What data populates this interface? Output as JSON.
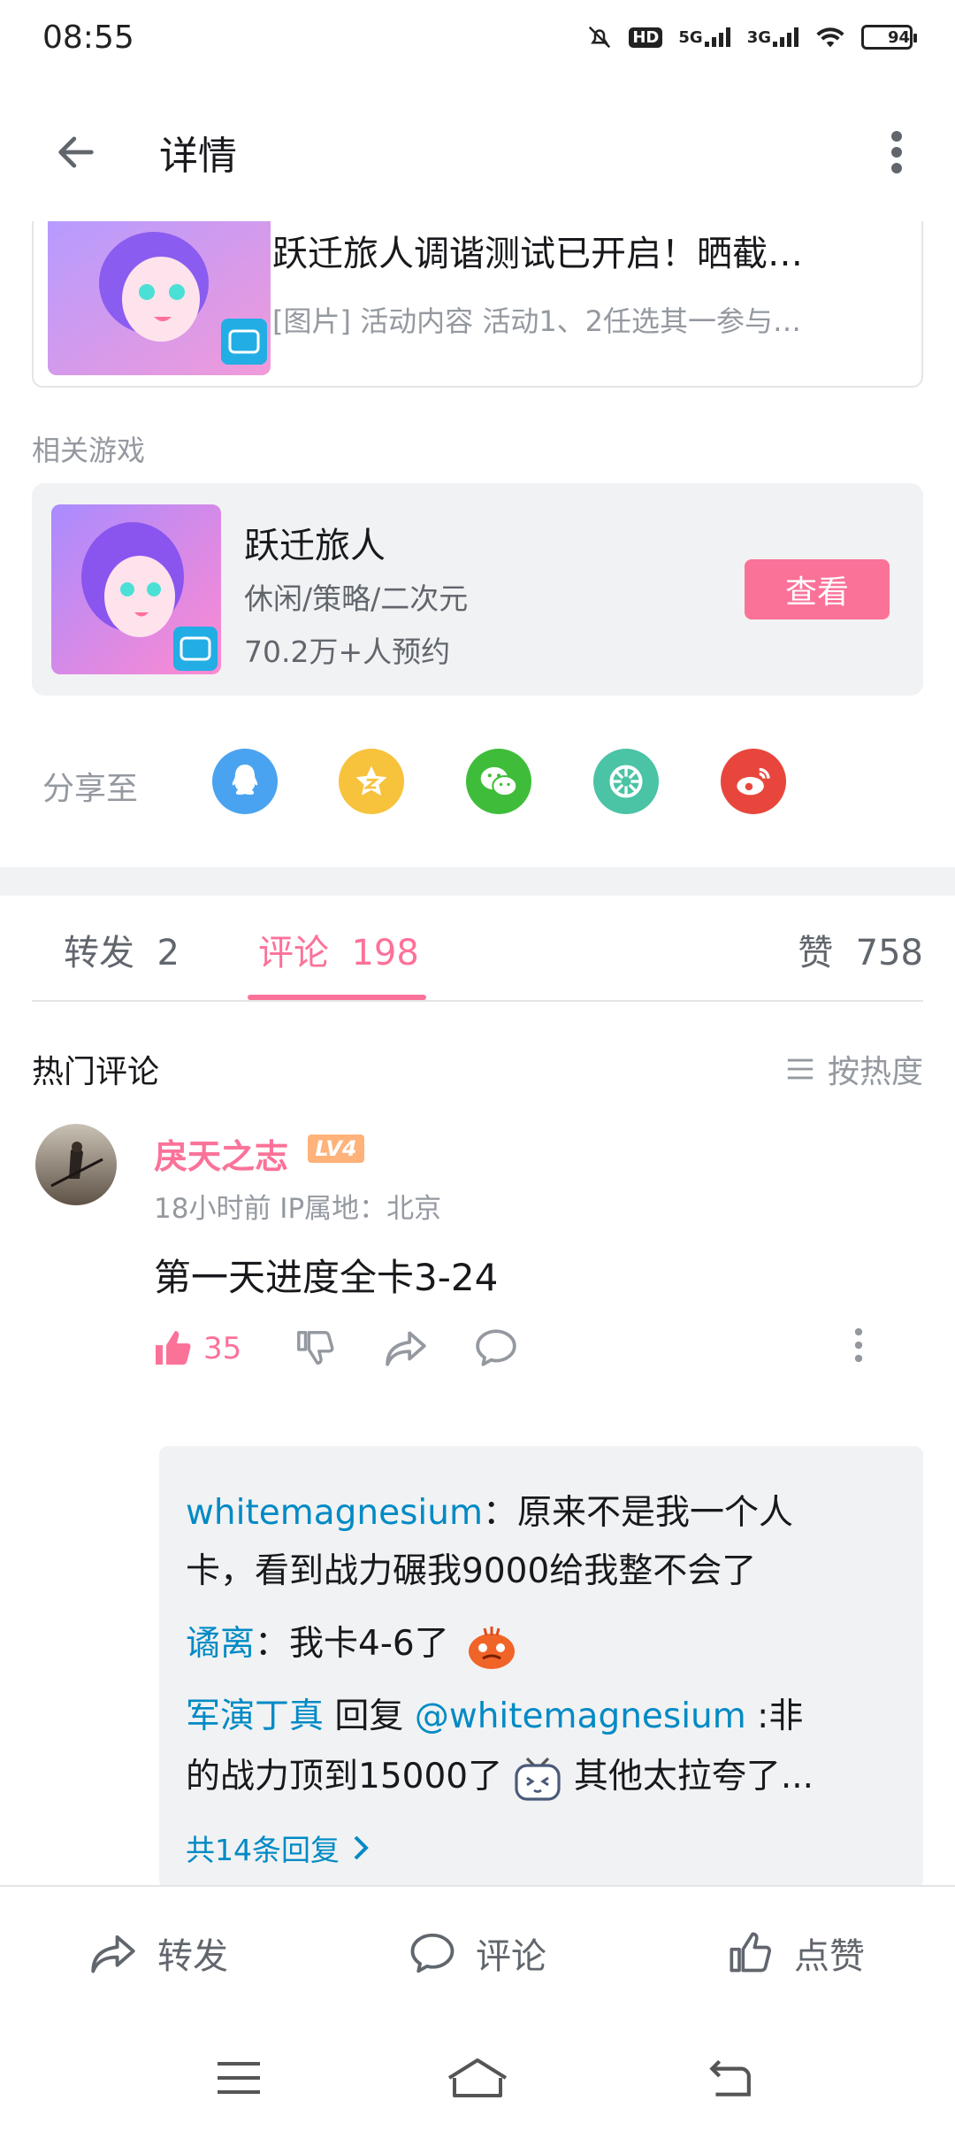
{
  "status_bar": {
    "time": "08:55",
    "network1": "5G",
    "network2": "3G",
    "hd_label": "HD",
    "battery": "94",
    "battery_level": 0.94
  },
  "app_bar": {
    "title": "详情"
  },
  "article": {
    "title": "跃迁旅人调谐测试已开启！晒截…",
    "subtitle": "[图片]  活动内容  活动1、2任选其一参与…"
  },
  "related": {
    "label": "相关游戏",
    "game_name": "跃迁旅人",
    "tags": "休闲/策略/二次元",
    "count": "70.2万+人预约",
    "view_label": "查看"
  },
  "share": {
    "label": "分享至",
    "targets": [
      "qq-icon",
      "qzone-icon",
      "wechat-icon",
      "moments-icon",
      "weibo-icon"
    ]
  },
  "tabs": {
    "repost_label": "转发",
    "repost_count": "2",
    "comment_label": "评论",
    "comment_count": "198",
    "like_label": "赞",
    "like_count": "758"
  },
  "comments_header": {
    "title": "热门评论",
    "sort_label": "按热度"
  },
  "comment": {
    "username": "戾天之志",
    "level": "LV4",
    "meta": "18小时前  IP属地：北京",
    "text": "第一天进度全卡3-24",
    "likes": "35"
  },
  "replies": {
    "r1_name": "whitemagnesium",
    "r1_text_a": "：原来不是我一个人",
    "r1_text_b": "卡，看到战力碾我9000给我整不会了",
    "r2_name": "谲离",
    "r2_text": "：我卡4-6了",
    "r3_name": "军演丁真",
    "r3_reply": " 回复 ",
    "r3_at": "@whitemagnesium",
    "r3_text_a": " :非",
    "r3_text_b1": "的战力顶到15000了",
    "r3_text_b2": "其他太拉夸了...",
    "more": "共14条回复"
  },
  "bottom_bar": {
    "repost": "转发",
    "comment": "评论",
    "like": "点赞"
  },
  "colors": {
    "accent": "#fb7299",
    "link": "#008ac5",
    "muted": "#9499a0"
  }
}
